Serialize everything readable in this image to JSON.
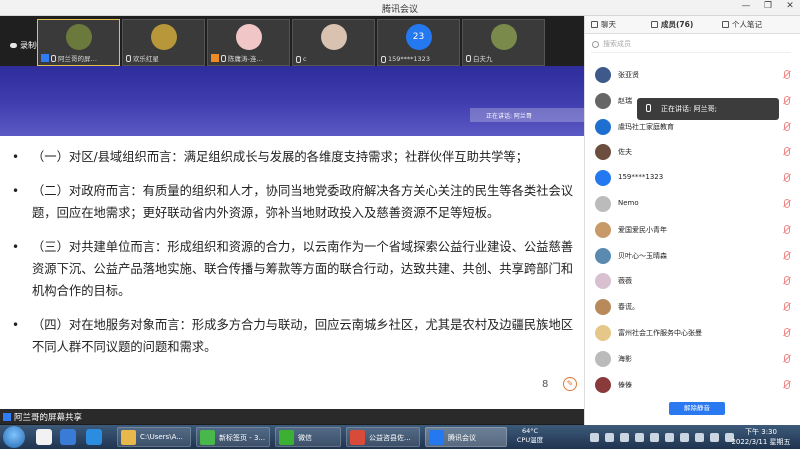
{
  "window": {
    "title": "腾讯会议",
    "buttons": [
      "—",
      "❐",
      "✕"
    ]
  },
  "recording": {
    "label": "录制中"
  },
  "participants_strip": [
    {
      "name": "阿兰哥的屏…",
      "active": true,
      "avatar_color": "#6b7a3c"
    },
    {
      "name": "欢乐红星",
      "active": false,
      "avatar_color": "#b8963a"
    },
    {
      "name": "陈庸涛-连…",
      "active": false,
      "avatar_color": "#f1c6c6"
    },
    {
      "name": "c",
      "active": false,
      "avatar_color": "#d9c2b0"
    },
    {
      "name": "159****1323",
      "active": false,
      "number": "23"
    },
    {
      "name": "白夫九",
      "active": false,
      "avatar_color": "#7a8a4a"
    }
  ],
  "slide": {
    "speaking_bar": "正在讲话: 阿兰哥",
    "bullets": [
      "（一）对区/县域组织而言：满足组织成长与发展的各维度支持需求；社群伙伴互助共学等；",
      "（二）对政府而言：有质量的组织和人才，协同当地党委政府解决各方关心关注的民生等各类社会议题，回应在地需求；更好联动省内外资源，弥补当地财政投入及慈善资源不足等短板。",
      "（三）对共建单位而言：形成组织和资源的合力，以云南作为一个省域探索公益行业建设、公益慈善资源下沉、公益产品落地实施、联合传播与筹款等方面的联合行动，达致共建、共创、共享跨部门和机构合作的目标。",
      "（四）对在地服务对象而言：形成多方合力与联动，回应云南城乡社区，尤其是农村及边疆民族地区不同人群不同议题的问题和需求。"
    ],
    "page": "8"
  },
  "share_status": "阿兰哥的屏幕共享",
  "panel": {
    "tabs": [
      {
        "label": "聊天"
      },
      {
        "label": "成员(76)"
      },
      {
        "label": "个人笔记"
      }
    ],
    "search_placeholder": "搜索成员",
    "members": [
      {
        "name": "张亚贤",
        "color": "#3d5a8a"
      },
      {
        "name": "赵瑞",
        "color": "#666666"
      },
      {
        "name": "虞玛社工家庭教育",
        "color": "#1f6fd1"
      },
      {
        "name": "佐夫",
        "color": "#6b4e3d"
      },
      {
        "name": "159****1323",
        "color": "#2478f0"
      },
      {
        "name": "Nemo",
        "color": "#bbbbbb"
      },
      {
        "name": "爱国爱民小青年",
        "color": "#c89a6a"
      },
      {
        "name": "贝叶心～玉晴森",
        "color": "#5a8ab0"
      },
      {
        "name": "薇薇",
        "color": "#d9c0d0"
      },
      {
        "name": "春谎。",
        "color": "#b88a5a"
      },
      {
        "name": "富州社会工作服务中心张曼",
        "color": "#e6c78a"
      },
      {
        "name": "海影",
        "color": "#bbbbbb"
      },
      {
        "name": "傣傣",
        "color": "#8a3a3a"
      }
    ],
    "unmute_button": "解除静音",
    "speaking_popup": "正在讲话: 阿兰哥;"
  },
  "taskbar": {
    "tasks": [
      {
        "label": "C:\\Users\\A...",
        "color": "#e8b84a"
      },
      {
        "label": "新标签页 - 3...",
        "color": "#48b84a"
      },
      {
        "label": "微信",
        "color": "#3cb034"
      },
      {
        "label": "公益咨县佐...",
        "color": "#d84a3a"
      },
      {
        "label": "腾讯会议",
        "color": "#2478f0"
      }
    ],
    "temp": "64°C",
    "temp_label": "CPU温度",
    "time": "下午 3:30",
    "date": "2022/3/11 星期五"
  }
}
